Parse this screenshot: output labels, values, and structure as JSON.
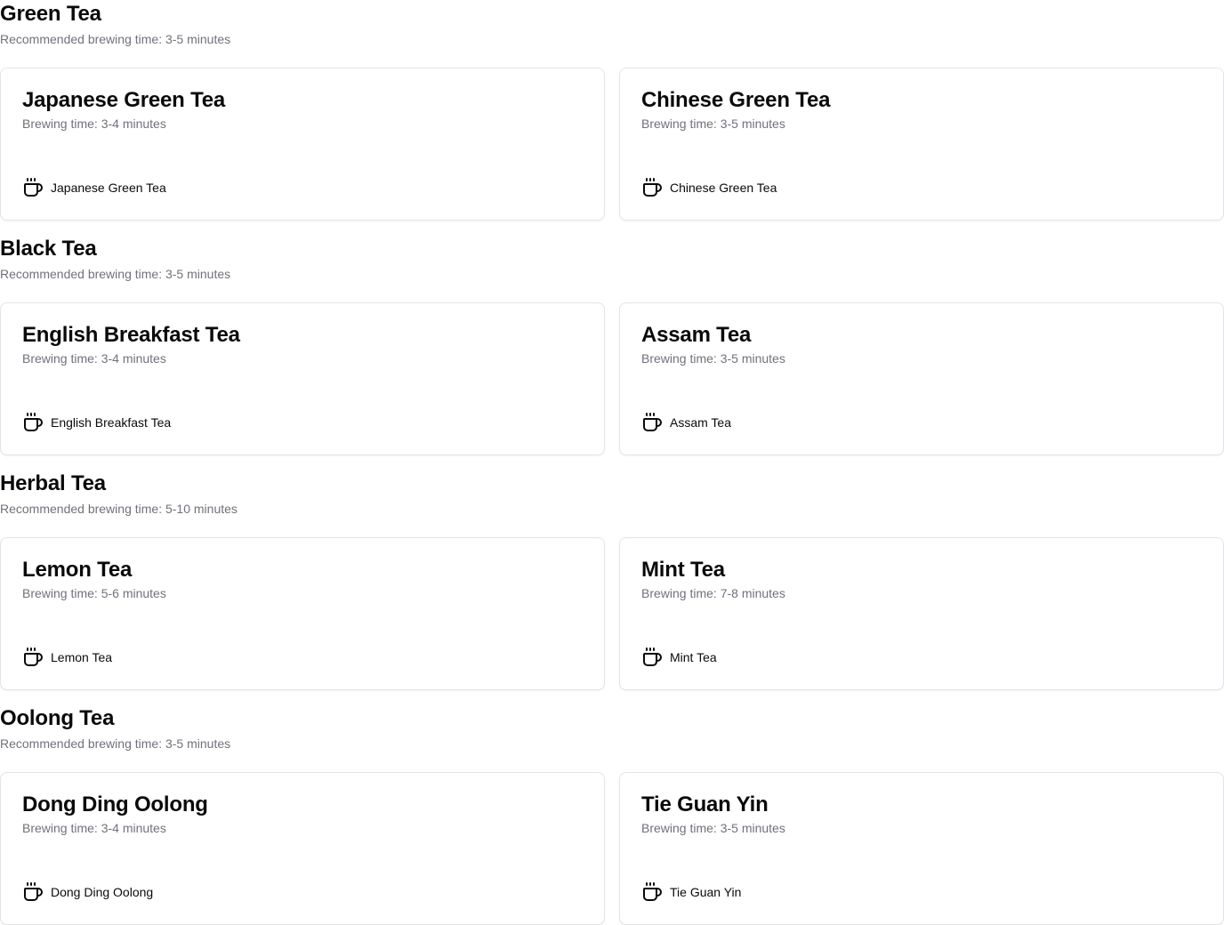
{
  "sections": [
    {
      "title": "Green Tea",
      "subtitle": "Recommended brewing time: 3-5 minutes",
      "cards": [
        {
          "title": "Japanese Green Tea",
          "brewing": "Brewing time: 3-4 minutes",
          "label": "Japanese Green Tea",
          "icon": "coffee-cup-icon"
        },
        {
          "title": "Chinese Green Tea",
          "brewing": "Brewing time: 3-5 minutes",
          "label": "Chinese Green Tea",
          "icon": "coffee-cup-icon"
        }
      ]
    },
    {
      "title": "Black Tea",
      "subtitle": "Recommended brewing time: 3-5 minutes",
      "cards": [
        {
          "title": "English Breakfast Tea",
          "brewing": "Brewing time: 3-4 minutes",
          "label": "English Breakfast Tea",
          "icon": "coffee-cup-icon"
        },
        {
          "title": "Assam Tea",
          "brewing": "Brewing time: 3-5 minutes",
          "label": "Assam Tea",
          "icon": "coffee-cup-icon"
        }
      ]
    },
    {
      "title": "Herbal Tea",
      "subtitle": "Recommended brewing time: 5-10 minutes",
      "cards": [
        {
          "title": "Lemon Tea",
          "brewing": "Brewing time: 5-6 minutes",
          "label": "Lemon Tea",
          "icon": "coffee-cup-icon"
        },
        {
          "title": "Mint Tea",
          "brewing": "Brewing time: 7-8 minutes",
          "label": "Mint Tea",
          "icon": "coffee-cup-icon"
        }
      ]
    },
    {
      "title": "Oolong Tea",
      "subtitle": "Recommended brewing time: 3-5 minutes",
      "cards": [
        {
          "title": "Dong Ding Oolong",
          "brewing": "Brewing time: 3-4 minutes",
          "label": "Dong Ding Oolong",
          "icon": "coffee-cup-icon"
        },
        {
          "title": "Tie Guan Yin",
          "brewing": "Brewing time: 3-5 minutes",
          "label": "Tie Guan Yin",
          "icon": "coffee-cup-icon"
        }
      ]
    }
  ]
}
